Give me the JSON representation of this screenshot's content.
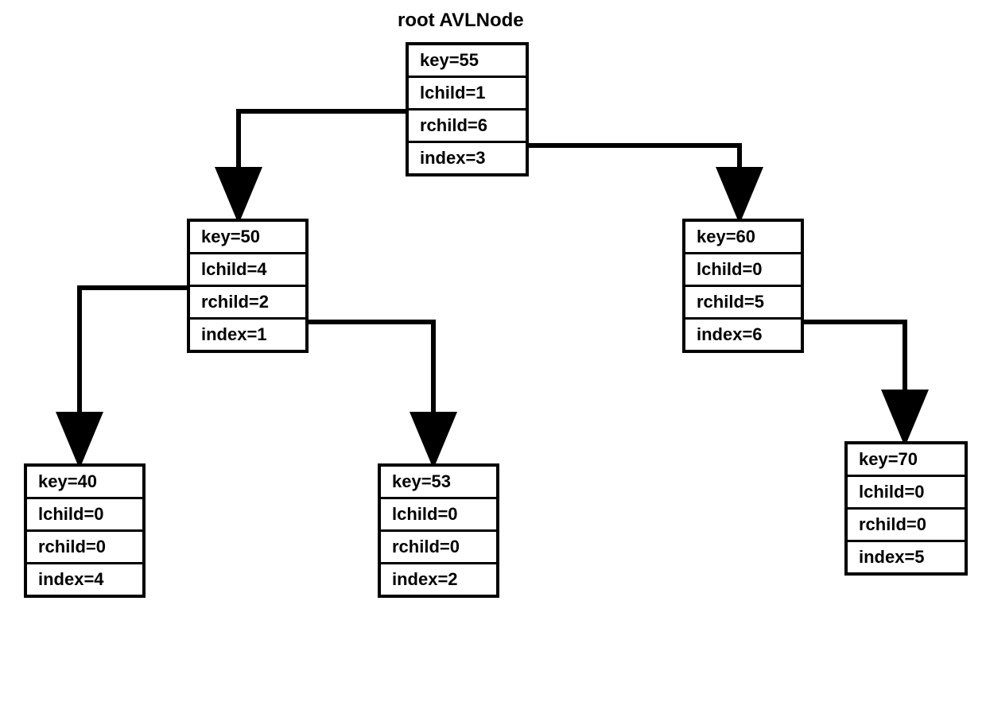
{
  "title": "root AVLNode",
  "nodes": {
    "root": {
      "key": "key=55",
      "lchild": "lchild=1",
      "rchild": "rchild=6",
      "index": "index=3"
    },
    "n50": {
      "key": "key=50",
      "lchild": "lchild=4",
      "rchild": "rchild=2",
      "index": "index=1"
    },
    "n60": {
      "key": "key=60",
      "lchild": "lchild=0",
      "rchild": "rchild=5",
      "index": "index=6"
    },
    "n40": {
      "key": "key=40",
      "lchild": "lchild=0",
      "rchild": "rchild=0",
      "index": "index=4"
    },
    "n53": {
      "key": "key=53",
      "lchild": "lchild=0",
      "rchild": "rchild=0",
      "index": "index=2"
    },
    "n70": {
      "key": "key=70",
      "lchild": "lchild=0",
      "rchild": "rchild=0",
      "index": "index=5"
    }
  }
}
